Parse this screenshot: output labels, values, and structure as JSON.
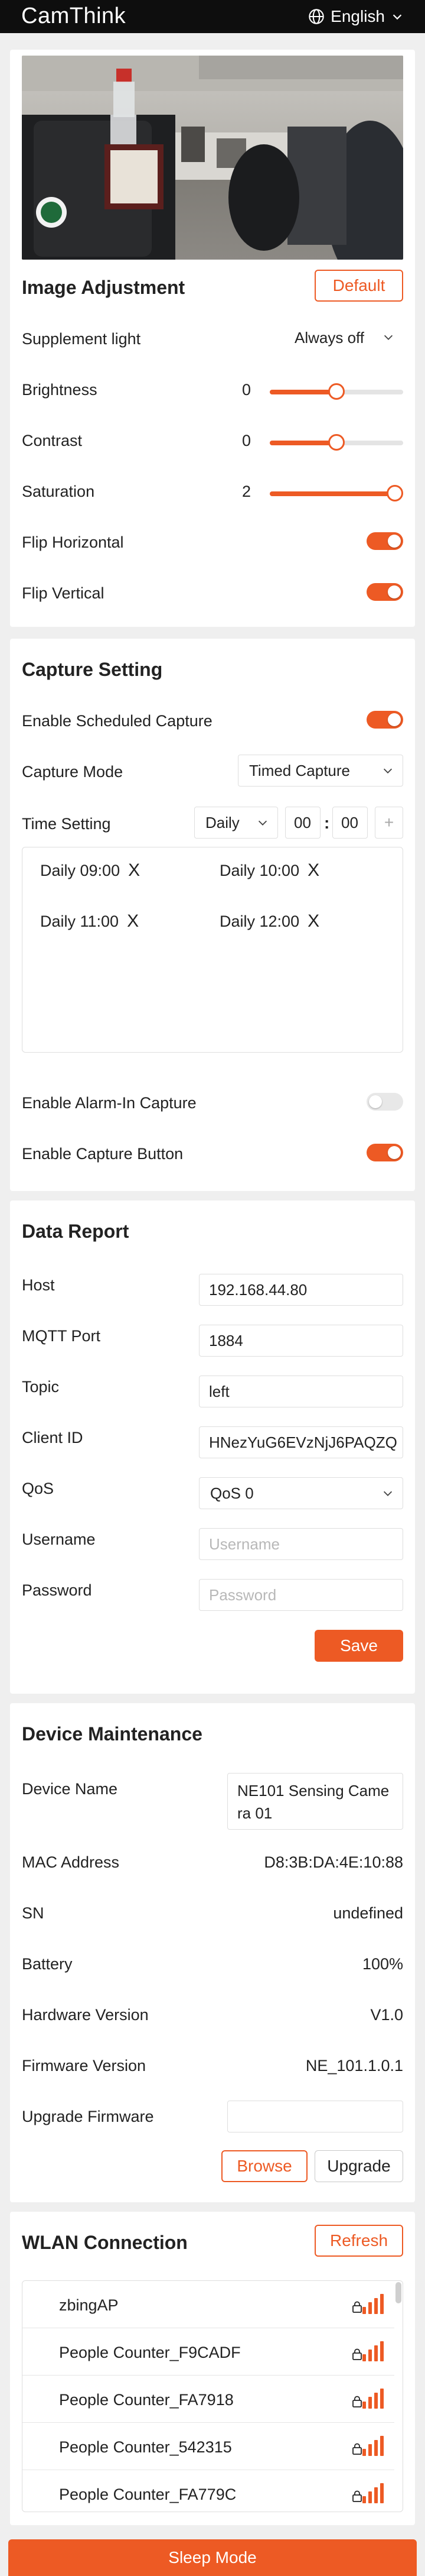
{
  "header": {
    "logo": "CamThink",
    "language": "English"
  },
  "image_adjustment": {
    "title": "Image Adjustment",
    "default_button": "Default",
    "supplement_light": {
      "label": "Supplement light",
      "value": "Always off"
    },
    "brightness": {
      "label": "Brightness",
      "value": "0",
      "level": 0.5
    },
    "contrast": {
      "label": "Contrast",
      "value": "0",
      "level": 0.5
    },
    "saturation": {
      "label": "Saturation",
      "value": "2",
      "level": 1.0
    },
    "flip_horizontal": {
      "label": "Flip Horizontal",
      "on": true
    },
    "flip_vertical": {
      "label": "Flip Vertical",
      "on": true
    }
  },
  "capture": {
    "title": "Capture Setting",
    "scheduled": {
      "label": "Enable Scheduled Capture",
      "on": true
    },
    "mode": {
      "label": "Capture Mode",
      "value": "Timed Capture"
    },
    "time_setting": {
      "label": "Time Setting",
      "frequency": "Daily",
      "hour": "00",
      "separator": ":",
      "minute": "00",
      "add": "+"
    },
    "schedules": [
      {
        "time": "Daily 09:00",
        "remove": "X"
      },
      {
        "time": "Daily 10:00",
        "remove": "X"
      },
      {
        "time": "Daily 11:00",
        "remove": "X"
      },
      {
        "time": "Daily 12:00",
        "remove": "X"
      }
    ],
    "alarm_in": {
      "label": "Enable Alarm-In Capture",
      "on": false
    },
    "capture_button": {
      "label": "Enable Capture Button",
      "on": true
    }
  },
  "data_report": {
    "title": "Data Report",
    "host": {
      "label": "Host",
      "value": "192.168.44.80"
    },
    "port": {
      "label": "MQTT Port",
      "value": "1884"
    },
    "topic": {
      "label": "Topic",
      "value": "left"
    },
    "client_id": {
      "label": "Client ID",
      "value": "HNezYuG6EVzNjJ6PAQZQ"
    },
    "qos": {
      "label": "QoS",
      "value": "QoS 0"
    },
    "username": {
      "label": "Username",
      "placeholder": "Username"
    },
    "password": {
      "label": "Password",
      "placeholder": "Password"
    },
    "save": "Save"
  },
  "maintenance": {
    "title": "Device Maintenance",
    "device_name": {
      "label": "Device Name",
      "line1": "NE101 Sensing Came",
      "line2": "ra 01"
    },
    "mac": {
      "label": "MAC Address",
      "value": "D8:3B:DA:4E:10:88"
    },
    "sn": {
      "label": "SN",
      "value": "undefined"
    },
    "battery": {
      "label": "Battery",
      "value": "100%"
    },
    "hardware": {
      "label": "Hardware Version",
      "value": "V1.0"
    },
    "firmware": {
      "label": "Firmware Version",
      "value": "NE_101.1.0.1"
    },
    "upgrade": {
      "label": "Upgrade Firmware",
      "browse": "Browse",
      "upgrade": "Upgrade"
    }
  },
  "wlan": {
    "title": "WLAN Connection",
    "refresh": "Refresh",
    "networks": [
      {
        "ssid": "zbingAP"
      },
      {
        "ssid": "People Counter_F9CADF"
      },
      {
        "ssid": "People Counter_FA7918"
      },
      {
        "ssid": "People Counter_542315"
      },
      {
        "ssid": "People Counter_FA779C"
      }
    ]
  },
  "footer": {
    "sleep": "Sleep Mode"
  },
  "colors": {
    "accent": "#ed5a24",
    "header_bg": "#0e0e0e",
    "page_bg": "#efefef"
  }
}
